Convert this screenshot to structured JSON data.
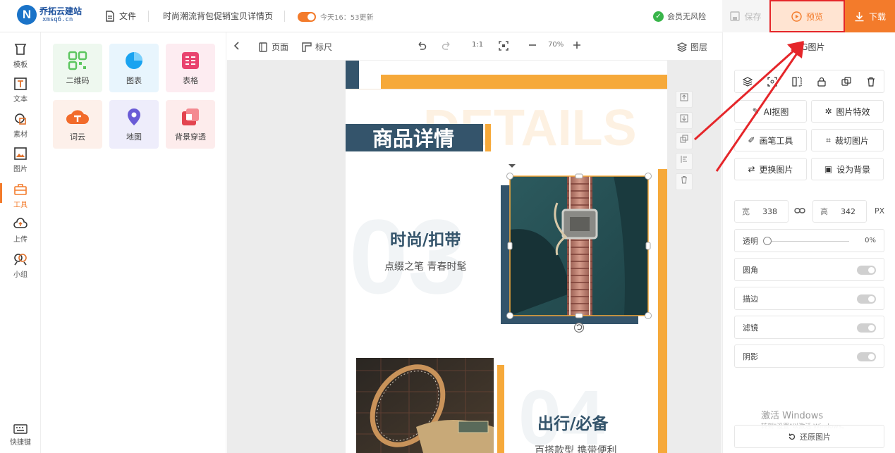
{
  "topbar": {
    "logo_cn": "乔拓云建站",
    "logo_en": "xmsq6.cn",
    "file_label": "文件",
    "doc_title": "时尚潮流背包促销宝贝详情页",
    "autosave_text": "今天16：53更新",
    "risk_text": "会员无风险",
    "save_label": "保存",
    "preview_label": "预览",
    "download_label": "下载"
  },
  "rail": {
    "items": [
      {
        "label": "模板",
        "icon": "template-icon"
      },
      {
        "label": "文本",
        "icon": "text-icon"
      },
      {
        "label": "素材",
        "icon": "material-icon"
      },
      {
        "label": "图片",
        "icon": "image-icon"
      },
      {
        "label": "工具",
        "icon": "toolbox-icon"
      },
      {
        "label": "上传",
        "icon": "upload-icon"
      },
      {
        "label": "小组",
        "icon": "group-icon"
      }
    ],
    "shortcut_label": "快捷键"
  },
  "tools": {
    "items": [
      {
        "label": "二维码",
        "icon": "qrcode-icon",
        "color": "#5cc65f"
      },
      {
        "label": "图表",
        "icon": "chart-icon",
        "color": "#1aa3f0"
      },
      {
        "label": "表格",
        "icon": "table-icon",
        "color": "#e9436f"
      },
      {
        "label": "词云",
        "icon": "wordcloud-icon",
        "color": "#f26b2b"
      },
      {
        "label": "地图",
        "icon": "map-pin-icon",
        "color": "#6a5bd6"
      },
      {
        "label": "背景穿透",
        "icon": "background-icon",
        "color": "#e3444f"
      }
    ]
  },
  "canvas_toolbar": {
    "page_label": "页面",
    "ruler_label": "标尺",
    "ratio_label": "1:1",
    "zoom_value": "70%",
    "layers_label": "图层"
  },
  "design": {
    "bg_word": "DETAILS",
    "heading": "商品详情",
    "num1": "03",
    "title1": "时尚/扣带",
    "sub1": "点缀之笔 青春时髦",
    "num2": "04",
    "title2": "出行/必备",
    "sub2": "百搭款型 携带便利"
  },
  "right_panel": {
    "title": "JPG图片",
    "buttons": [
      {
        "label": "AI抠图",
        "icon": "ai-cutout-icon"
      },
      {
        "label": "图片特效",
        "icon": "effects-icon"
      },
      {
        "label": "画笔工具",
        "icon": "brush-icon"
      },
      {
        "label": "裁切图片",
        "icon": "crop-icon"
      },
      {
        "label": "更换图片",
        "icon": "replace-icon"
      },
      {
        "label": "设为背景",
        "icon": "set-background-icon"
      }
    ],
    "width_label": "宽",
    "width_value": "338",
    "height_label": "高",
    "height_value": "342",
    "unit": "PX",
    "opacity_label": "透明",
    "opacity_value": "0%",
    "opacity": 0,
    "toggles": [
      {
        "label": "圆角"
      },
      {
        "label": "描边"
      },
      {
        "label": "滤镜"
      },
      {
        "label": "阴影"
      }
    ],
    "restore_label": "还原图片",
    "watermark_line1": "激活 Windows",
    "watermark_line2": "转到\"设置\"以激活 Windows。"
  },
  "colors": {
    "accent": "#f37b2b",
    "highlight_red": "#e5262a",
    "navy": "#34546b",
    "gold": "#f6a93a"
  }
}
